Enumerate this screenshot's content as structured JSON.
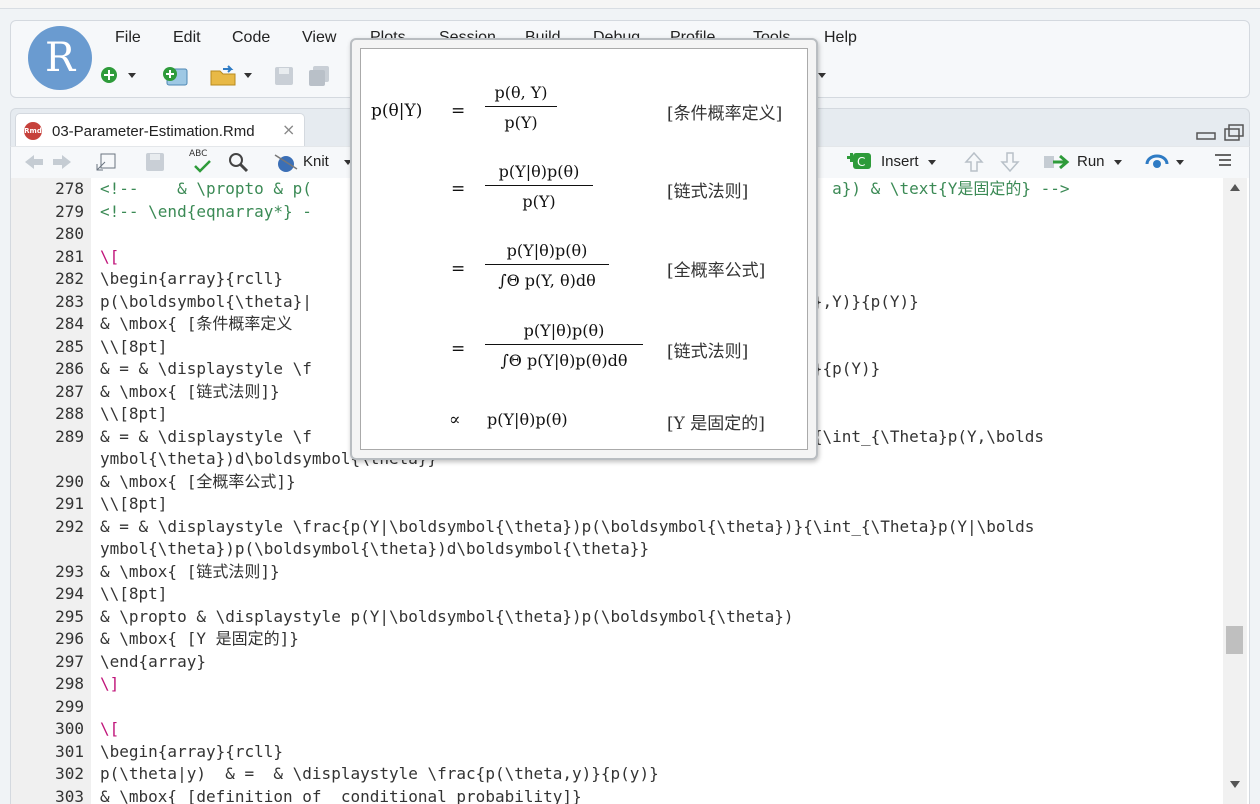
{
  "menu": [
    "File",
    "Edit",
    "Code",
    "View",
    "Plots",
    "Session",
    "Build",
    "Debug",
    "Profile",
    "Tools",
    "Help"
  ],
  "logo_letter": "R",
  "tab": {
    "filename": "03-Parameter-Estimation.Rmd",
    "close": "×",
    "badge": "Rmd"
  },
  "editor_toolbar": {
    "knit": "Knit",
    "insert": "Insert",
    "run": "Run",
    "spell": "ABC"
  },
  "lines": [
    {
      "n": "278",
      "segs": [
        {
          "t": "<!--    & \\propto & p(",
          "c": "cm"
        },
        {
          "t": "                                                      ",
          "c": ""
        },
        {
          "t": "a}) & \\text{Y是固定的} -->",
          "c": "cm"
        }
      ]
    },
    {
      "n": "279",
      "segs": [
        {
          "t": "<!-- \\end{eqnarray*} -",
          "c": "cm"
        }
      ]
    },
    {
      "n": "280",
      "segs": []
    },
    {
      "n": "281",
      "segs": [
        {
          "t": "\\[",
          "c": "mg"
        }
      ]
    },
    {
      "n": "282",
      "segs": [
        {
          "t": "\\begin{array}{rcll}",
          "c": ""
        }
      ]
    },
    {
      "n": "283",
      "segs": [
        {
          "t": "p(\\boldsymbol{\\theta}|                                          bol{\\theta},Y)}{p(Y)}",
          "c": ""
        }
      ]
    },
    {
      "n": "284",
      "segs": [
        {
          "t": "& \\mbox{ [条件概率定义",
          "c": ""
        }
      ]
    },
    {
      "n": "285",
      "segs": [
        {
          "t": "\\\\[8pt]",
          "c": ""
        }
      ]
    },
    {
      "n": "286",
      "segs": [
        {
          "t": "& = & \\displaystyle \\f                                          l{\\theta})}{p(Y)}",
          "c": ""
        }
      ]
    },
    {
      "n": "287",
      "segs": [
        {
          "t": "& \\mbox{ [链式法则]}",
          "c": ""
        }
      ]
    },
    {
      "n": "288",
      "segs": [
        {
          "t": "\\\\[8pt]",
          "c": ""
        }
      ]
    },
    {
      "n": "289",
      "segs": [
        {
          "t": "& = & \\displaystyle \\f                                          {\\theta})}{\\int_{\\Theta}p(Y,\\bolds",
          "c": ""
        }
      ]
    },
    {
      "n": "",
      "segs": [
        {
          "t": "ymbol{\\theta})d\\boldsymbol{\\theta}}",
          "c": ""
        }
      ]
    },
    {
      "n": "290",
      "segs": [
        {
          "t": "& \\mbox{ [全概率公式]}",
          "c": ""
        }
      ]
    },
    {
      "n": "291",
      "segs": [
        {
          "t": "\\\\[8pt]",
          "c": ""
        }
      ]
    },
    {
      "n": "292",
      "segs": [
        {
          "t": "& = & \\displaystyle \\frac{p(Y|\\boldsymbol{\\theta})p(\\boldsymbol{\\theta})}{\\int_{\\Theta}p(Y|\\bolds",
          "c": ""
        }
      ]
    },
    {
      "n": "",
      "segs": [
        {
          "t": "ymbol{\\theta})p(\\boldsymbol{\\theta})d\\boldsymbol{\\theta}}",
          "c": ""
        }
      ]
    },
    {
      "n": "293",
      "segs": [
        {
          "t": "& \\mbox{ [链式法则]}",
          "c": ""
        }
      ]
    },
    {
      "n": "294",
      "segs": [
        {
          "t": "\\\\[8pt]",
          "c": ""
        }
      ]
    },
    {
      "n": "295",
      "segs": [
        {
          "t": "& \\propto & \\displaystyle p(Y|\\boldsymbol{\\theta})p(\\boldsymbol{\\theta})",
          "c": ""
        }
      ]
    },
    {
      "n": "296",
      "segs": [
        {
          "t": "& \\mbox{ [Y 是固定的]}",
          "c": ""
        }
      ]
    },
    {
      "n": "297",
      "segs": [
        {
          "t": "\\end{array}",
          "c": ""
        }
      ]
    },
    {
      "n": "298",
      "segs": [
        {
          "t": "\\]",
          "c": "mg"
        }
      ]
    },
    {
      "n": "299",
      "segs": []
    },
    {
      "n": "300",
      "segs": [
        {
          "t": "\\[",
          "c": "mg"
        }
      ]
    },
    {
      "n": "301",
      "segs": [
        {
          "t": "\\begin{array}{rcll}",
          "c": ""
        }
      ]
    },
    {
      "n": "302",
      "segs": [
        {
          "t": "p(\\theta|y)  & =  & \\displaystyle \\frac{p(\\theta,y)}{p(y)}",
          "c": ""
        }
      ]
    },
    {
      "n": "303",
      "segs": [
        {
          "t": "& \\mbox{ [definition of  conditional probability]}",
          "c": ""
        }
      ]
    }
  ],
  "preview": {
    "lhs": "p(θ|Y)",
    "eq": "=",
    "propto": "∝",
    "rows": [
      {
        "num": "p(θ, Y)",
        "den": "p(Y)",
        "note": "[条件概率定义]"
      },
      {
        "num": "p(Y|θ)p(θ)",
        "den": "p(Y)",
        "note": "[链式法则]"
      },
      {
        "num": "p(Y|θ)p(θ)",
        "den": "∫Θ p(Y, θ)dθ",
        "note": "[全概率公式]"
      },
      {
        "num": "p(Y|θ)p(θ)",
        "den": "∫Θ p(Y|θ)p(θ)dθ",
        "note": "[链式法则]"
      }
    ],
    "last": {
      "expr": "p(Y|θ)p(θ)",
      "note": "[Y 是固定的]"
    }
  }
}
